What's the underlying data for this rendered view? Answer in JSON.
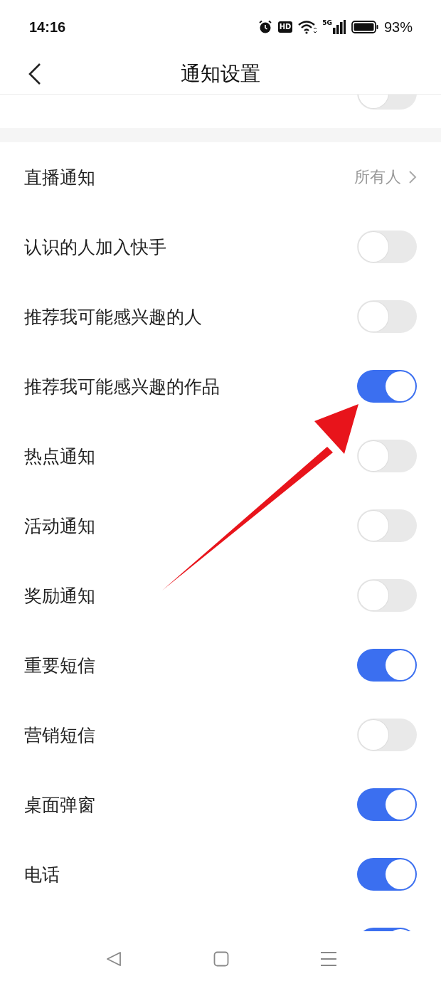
{
  "status_bar": {
    "time": "14:16",
    "hd": "HD",
    "network": "5G",
    "battery_text": "93%"
  },
  "header": {
    "title": "通知设置"
  },
  "sections": [
    {
      "items": [
        {
          "kind": "toggle",
          "on": false
        }
      ]
    },
    {
      "items": [
        {
          "kind": "link",
          "label": "直播通知",
          "value": "所有人"
        },
        {
          "kind": "toggle",
          "label": "认识的人加入快手",
          "on": false
        },
        {
          "kind": "toggle",
          "label": "推荐我可能感兴趣的人",
          "on": false
        },
        {
          "kind": "toggle",
          "label": "推荐我可能感兴趣的作品",
          "on": true
        },
        {
          "kind": "toggle",
          "label": "热点通知",
          "on": false
        },
        {
          "kind": "toggle",
          "label": "活动通知",
          "on": false
        },
        {
          "kind": "toggle",
          "label": "奖励通知",
          "on": false
        },
        {
          "kind": "toggle",
          "label": "重要短信",
          "on": true
        },
        {
          "kind": "toggle",
          "label": "营销短信",
          "on": false
        },
        {
          "kind": "toggle",
          "label": "桌面弹窗",
          "on": true
        },
        {
          "kind": "toggle",
          "label": "电话",
          "on": true
        },
        {
          "kind": "toggle",
          "on": true
        }
      ]
    }
  ]
}
